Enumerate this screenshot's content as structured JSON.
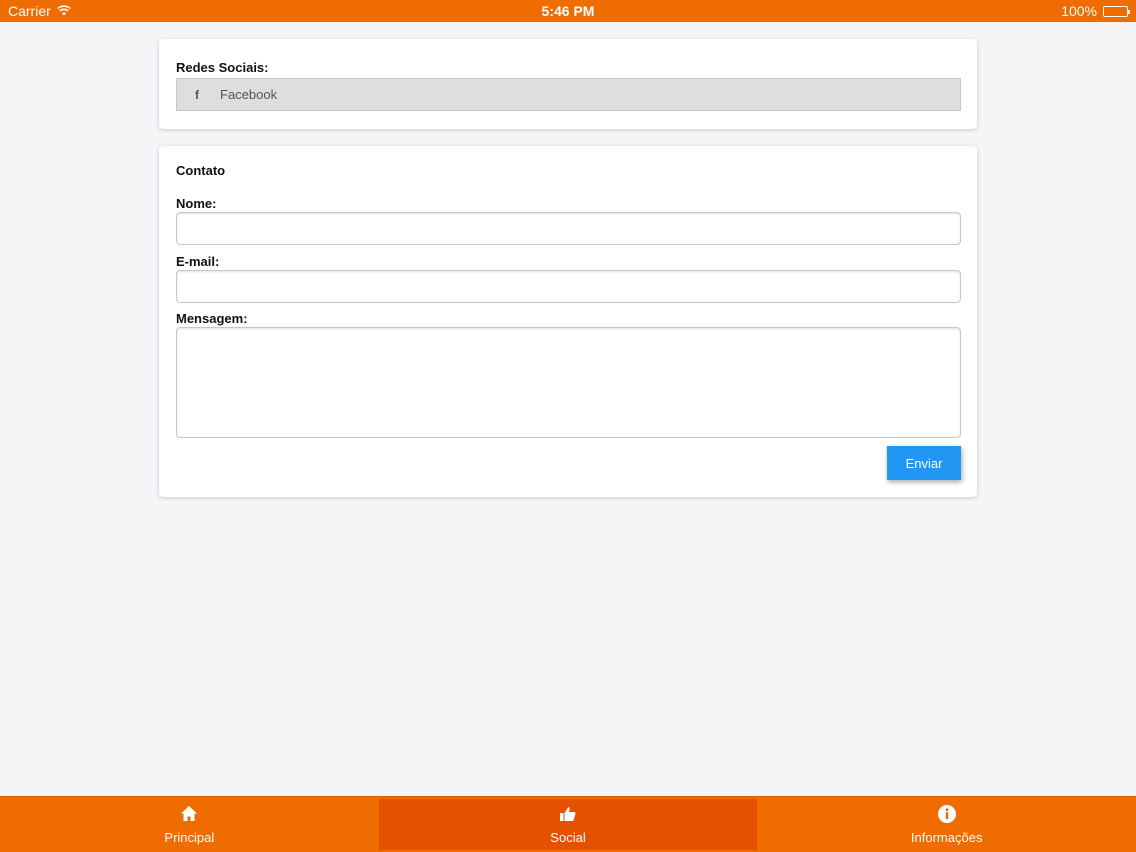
{
  "status_bar": {
    "carrier": "Carrier",
    "time": "5:46 PM",
    "battery": "100%"
  },
  "social": {
    "title": "Redes Sociais:",
    "items": [
      {
        "icon": "facebook-icon",
        "icon_glyph": "f",
        "label": "Facebook"
      }
    ]
  },
  "contact": {
    "title": "Contato",
    "name_label": "Nome:",
    "name_value": "",
    "email_label": "E-mail:",
    "email_value": "",
    "message_label": "Mensagem:",
    "message_value": "",
    "send_label": "Enviar"
  },
  "tabs": [
    {
      "label": "Principal",
      "icon": "home-icon",
      "active": false
    },
    {
      "label": "Social",
      "icon": "thumbs-up-icon",
      "active": true
    },
    {
      "label": "Informações",
      "icon": "info-icon",
      "active": false
    }
  ],
  "colors": {
    "brand": "#ef6c00",
    "active_tab": "#e65100",
    "button": "#2196f3"
  }
}
